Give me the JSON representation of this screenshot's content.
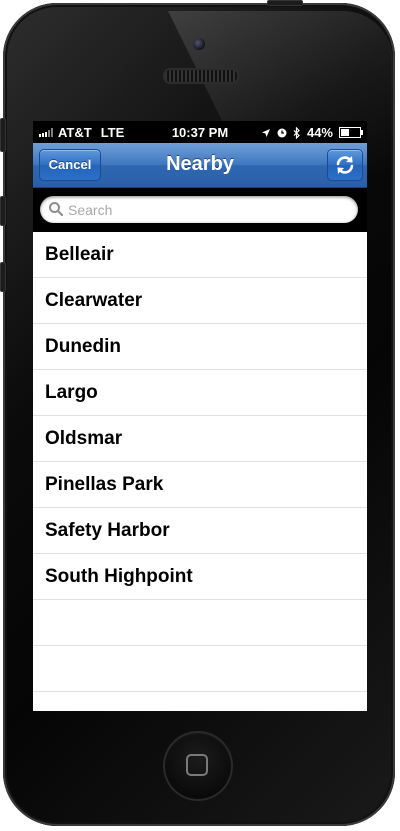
{
  "status_bar": {
    "carrier": "AT&T",
    "network": "LTE",
    "time": "10:37 PM",
    "battery": "44%",
    "battery_level": 0.44,
    "icons": [
      "signal-bars-icon",
      "location-arrow-icon",
      "alarm-clock-icon",
      "bluetooth-icon",
      "battery-icon"
    ]
  },
  "nav": {
    "title": "Nearby",
    "cancel_label": "Cancel",
    "refresh_icon": "refresh-icon"
  },
  "search": {
    "placeholder": "Search",
    "value": ""
  },
  "list": {
    "items": [
      "Belleair",
      "Clearwater",
      "Dunedin",
      "Largo",
      "Oldsmar",
      "Pinellas Park",
      "Safety Harbor",
      "South Highpoint"
    ],
    "empty_rows": 2
  },
  "colors": {
    "navbar_blue": "#3f77bf",
    "button_blue": "#2f6fc3",
    "screen_bg": "#ffffff",
    "separator": "#e0e0e0"
  }
}
